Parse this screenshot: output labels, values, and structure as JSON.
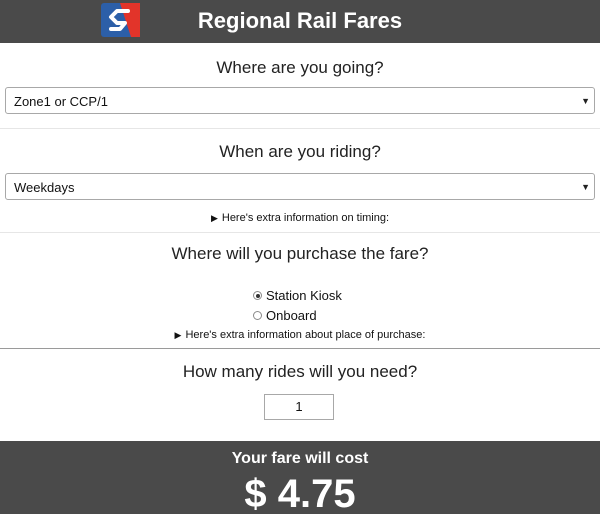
{
  "header": {
    "title": "Regional Rail Fares",
    "logo_icon": "septa-logo-icon",
    "logo_colors": {
      "blue": "#2c5fa8",
      "red": "#e2342a",
      "white": "#ffffff"
    },
    "background": "#4a4a4a"
  },
  "destination": {
    "question": "Where are you going?",
    "selected": "Zone1 or CCP/1"
  },
  "timing": {
    "question": "When are you riding?",
    "selected": "Weekdays",
    "extra_info": "Here's extra information on timing:"
  },
  "purchase": {
    "question": "Where will you purchase the fare?",
    "options": [
      {
        "label": "Station Kiosk",
        "checked": true
      },
      {
        "label": "Onboard",
        "checked": false
      }
    ],
    "extra_info": "Here's extra information about place of purchase:"
  },
  "rides": {
    "question": "How many rides will you need?",
    "value": "1"
  },
  "result": {
    "label": "Your fare will cost",
    "currency": "$",
    "amount": "4.75"
  }
}
